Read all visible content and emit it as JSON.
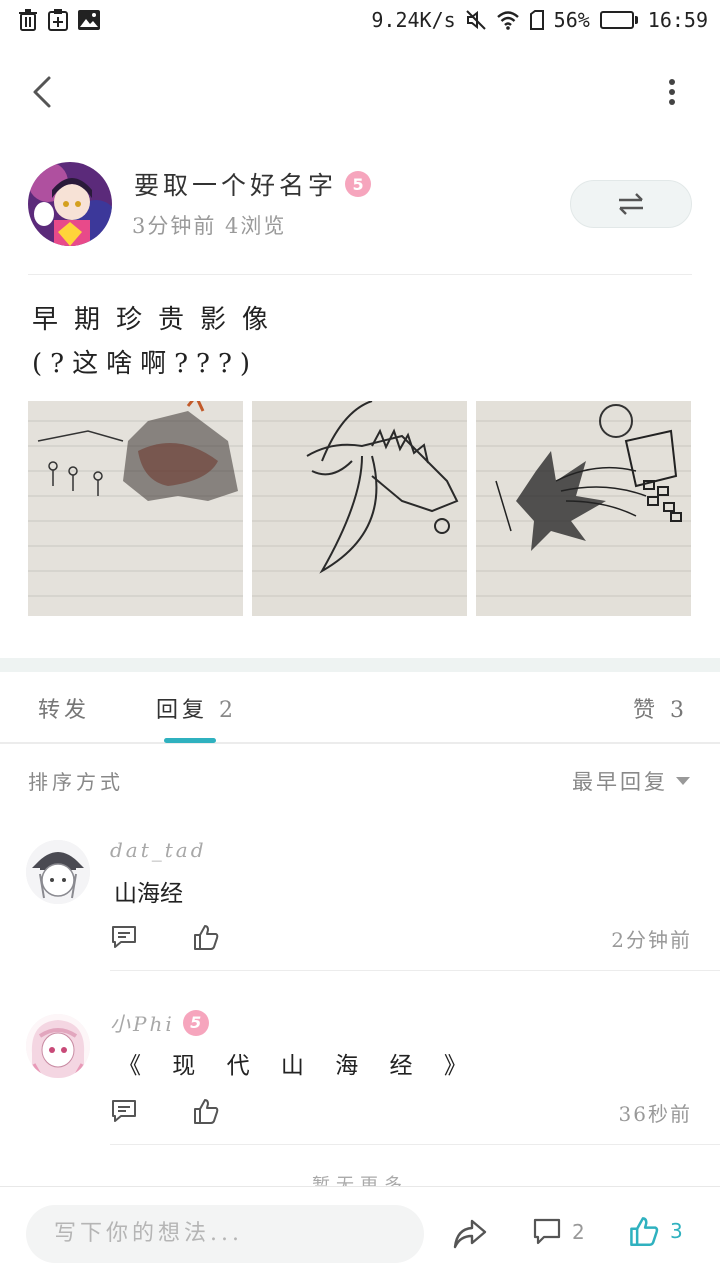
{
  "status_bar": {
    "speed": "9.24K/s",
    "battery_percent": "56%",
    "battery_level": 0.56,
    "time": "16:59"
  },
  "post": {
    "author_name": "要取一个好名字",
    "author_level": "5",
    "meta": "3分钟前 4浏览",
    "body_line1": "早期珍贵影像",
    "body_line2": "(?这啥啊???)"
  },
  "tabs": {
    "repost": "转发",
    "reply": "回复",
    "reply_count": "2",
    "like": "赞",
    "like_count": "3"
  },
  "sort": {
    "label": "排序方式",
    "value": "最早回复"
  },
  "comments": [
    {
      "name": "dat_tad",
      "text": "山海经",
      "time": "2分钟前"
    },
    {
      "name": "小Phi",
      "level": "5",
      "text": "《 现 代 山 海 经 》",
      "time": "36秒前"
    }
  ],
  "no_more": "暂无更多",
  "bottom_bar": {
    "placeholder": "写下你的想法...",
    "comment_count": "2",
    "like_count": "3"
  },
  "colors": {
    "accent": "#2fb1bf",
    "level_badge": "#f6a5bd",
    "battery": "#3ec03e"
  }
}
